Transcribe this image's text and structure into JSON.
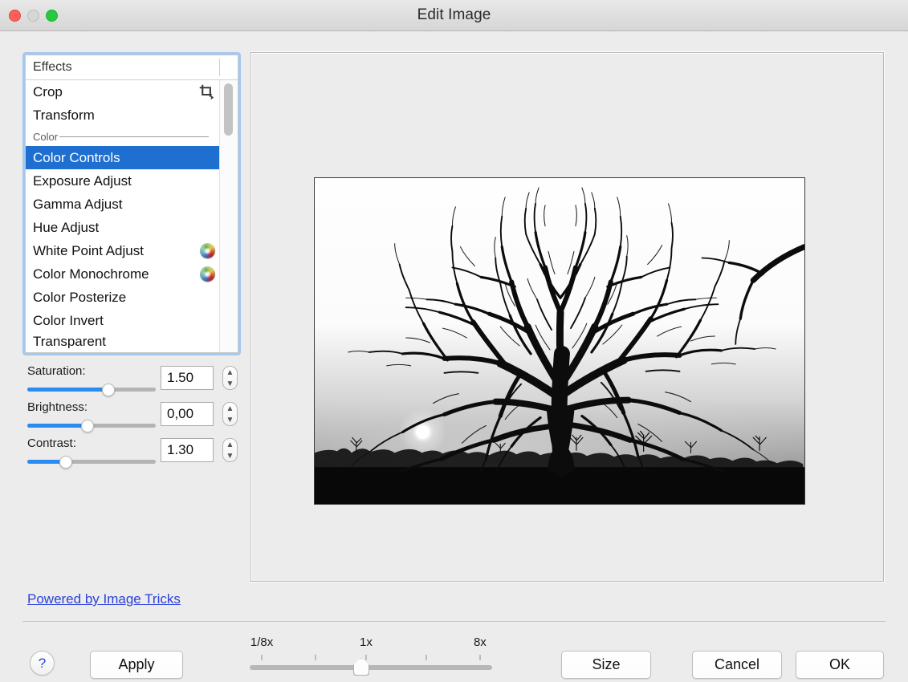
{
  "window": {
    "title": "Edit Image",
    "traffic_lights": [
      "close",
      "minimize",
      "maximize"
    ]
  },
  "effects_list": {
    "header_label": "Effects",
    "items": [
      {
        "label": "Crop",
        "icon": "crop-icon",
        "selected": false,
        "group": null
      },
      {
        "label": "Transform",
        "icon": null,
        "selected": false,
        "group": null
      },
      {
        "label": "Color",
        "icon": null,
        "selected": false,
        "group": "separator"
      },
      {
        "label": "Color Controls",
        "icon": null,
        "selected": true,
        "group": null
      },
      {
        "label": "Exposure Adjust",
        "icon": null,
        "selected": false,
        "group": null
      },
      {
        "label": "Gamma Adjust",
        "icon": null,
        "selected": false,
        "group": null
      },
      {
        "label": "Hue Adjust",
        "icon": null,
        "selected": false,
        "group": null
      },
      {
        "label": "White Point Adjust",
        "icon": "color-wheel-icon",
        "selected": false,
        "group": null
      },
      {
        "label": "Color Monochrome",
        "icon": "color-wheel-icon",
        "selected": false,
        "group": null
      },
      {
        "label": "Color Posterize",
        "icon": null,
        "selected": false,
        "group": null
      },
      {
        "label": "Color Invert",
        "icon": null,
        "selected": false,
        "group": null
      },
      {
        "label": "Transparent",
        "icon": null,
        "selected": false,
        "group": null
      }
    ],
    "selected_item": "Color Controls",
    "scrollbar_visible": true
  },
  "parameters": [
    {
      "label": "Saturation:",
      "value": "1.50",
      "slider_percent": 63
    },
    {
      "label": "Brightness:",
      "value": "0,00",
      "slider_percent": 47
    },
    {
      "label": "Contrast:",
      "value": "1.30",
      "slider_percent": 30
    }
  ],
  "stepper_up": "▲",
  "stepper_down": "▼",
  "powered_by": "Powered by Image Tricks",
  "preview": {
    "image_alt": "Black and white silhouette of a bare tree at sunset",
    "sun_visible": true
  },
  "zoom_slider": {
    "min_label": "1/8x",
    "mid_label": "1x",
    "max_label": "8x",
    "value_percent": 46,
    "tick_percents": [
      5,
      27,
      48,
      73,
      95
    ],
    "label_percents": [
      5,
      48,
      95
    ]
  },
  "buttons": {
    "help": "?",
    "apply": "Apply",
    "size": "Size",
    "cancel": "Cancel",
    "ok": "OK"
  },
  "colors": {
    "selection_blue": "#1f6fd0",
    "slider_blue": "#2a8bf2",
    "link_blue": "#2b41d8",
    "window_bg": "#ececec",
    "focus_ring": "#a5c8ef"
  }
}
